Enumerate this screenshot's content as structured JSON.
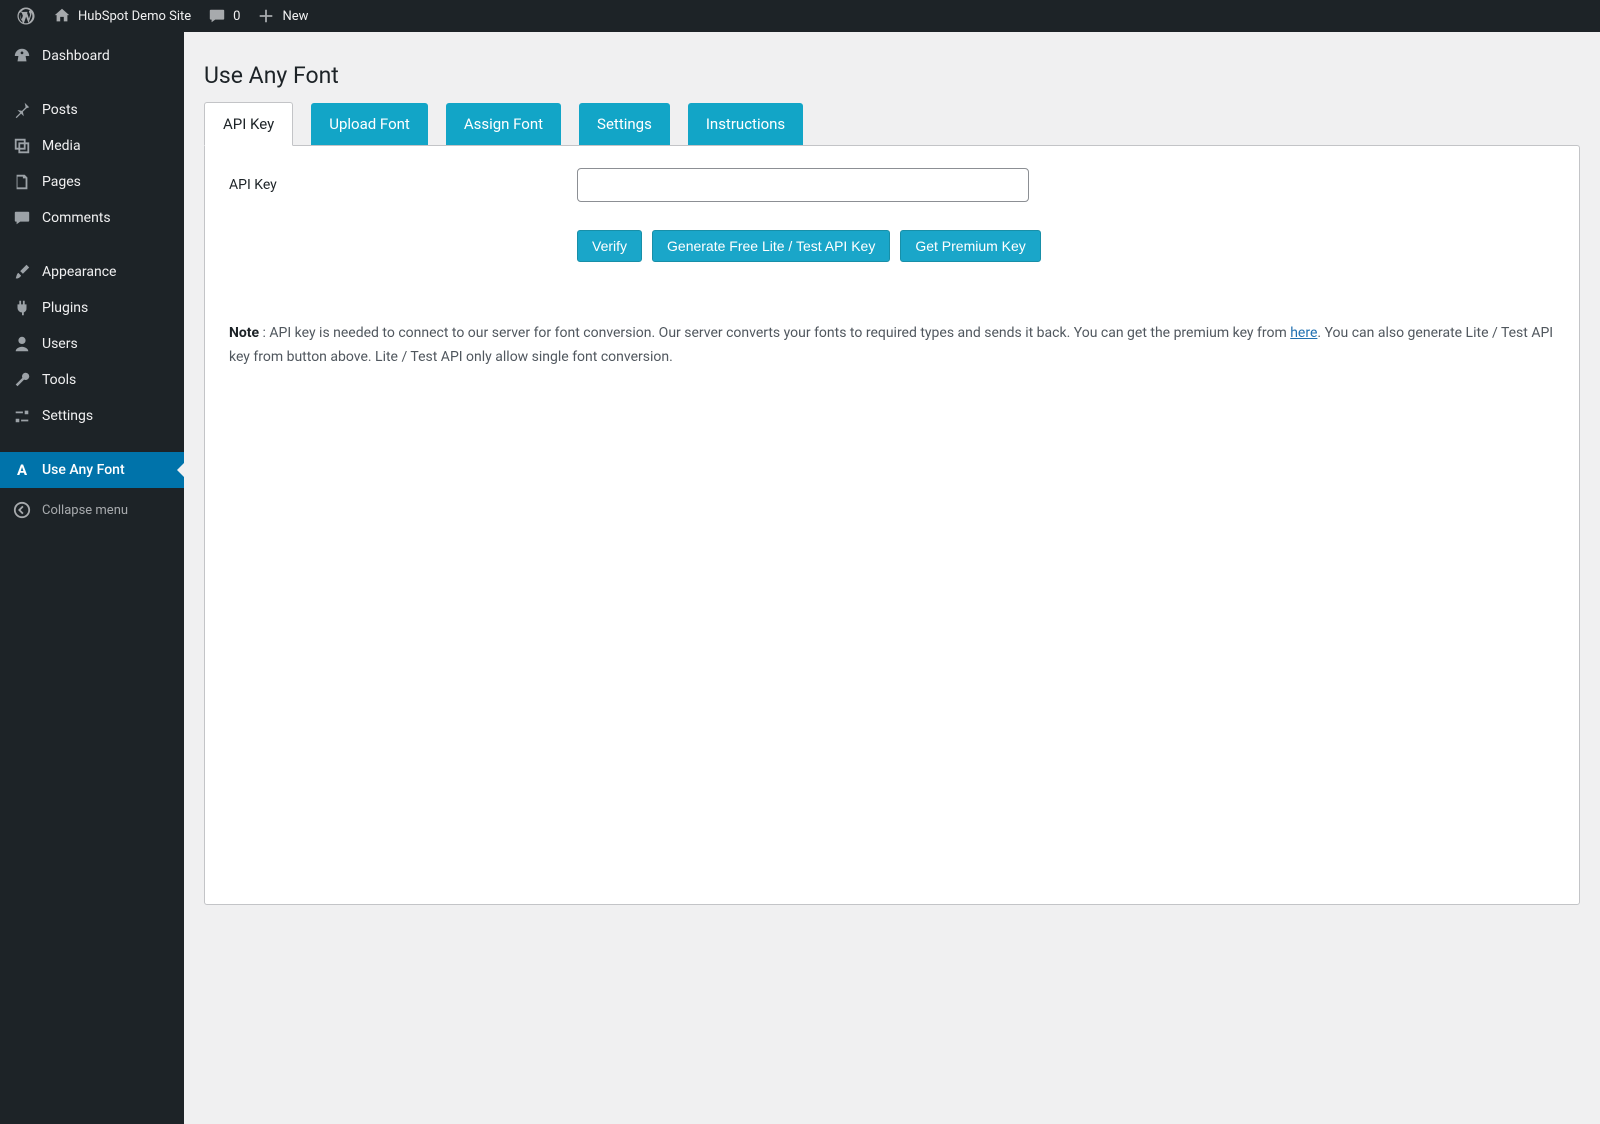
{
  "adminbar": {
    "site_title": "HubSpot Demo Site",
    "comments_count": "0",
    "new_label": "New"
  },
  "sidebar": {
    "items": [
      {
        "label": "Dashboard"
      },
      {
        "label": "Posts"
      },
      {
        "label": "Media"
      },
      {
        "label": "Pages"
      },
      {
        "label": "Comments"
      },
      {
        "label": "Appearance"
      },
      {
        "label": "Plugins"
      },
      {
        "label": "Users"
      },
      {
        "label": "Tools"
      },
      {
        "label": "Settings"
      },
      {
        "label": "Use Any Font"
      }
    ],
    "collapse_label": "Collapse menu"
  },
  "page": {
    "title": "Use Any Font"
  },
  "tabs": [
    {
      "label": "API Key",
      "active": true
    },
    {
      "label": "Upload Font",
      "active": false
    },
    {
      "label": "Assign Font",
      "active": false
    },
    {
      "label": "Settings",
      "active": false
    },
    {
      "label": "Instructions",
      "active": false
    }
  ],
  "form": {
    "api_key_label": "API Key",
    "api_key_value": "",
    "verify_button": "Verify",
    "generate_button": "Generate Free Lite / Test API Key",
    "premium_button": "Get Premium Key"
  },
  "note": {
    "strong": "Note",
    "part1": " : API key is needed to connect to our server for font conversion. Our server converts your fonts to required types and sends it back. You can get the premium key from ",
    "link_text": "here",
    "part2": ". You can also generate Lite / Test API key from button above. Lite / Test API only allow single font conversion."
  }
}
